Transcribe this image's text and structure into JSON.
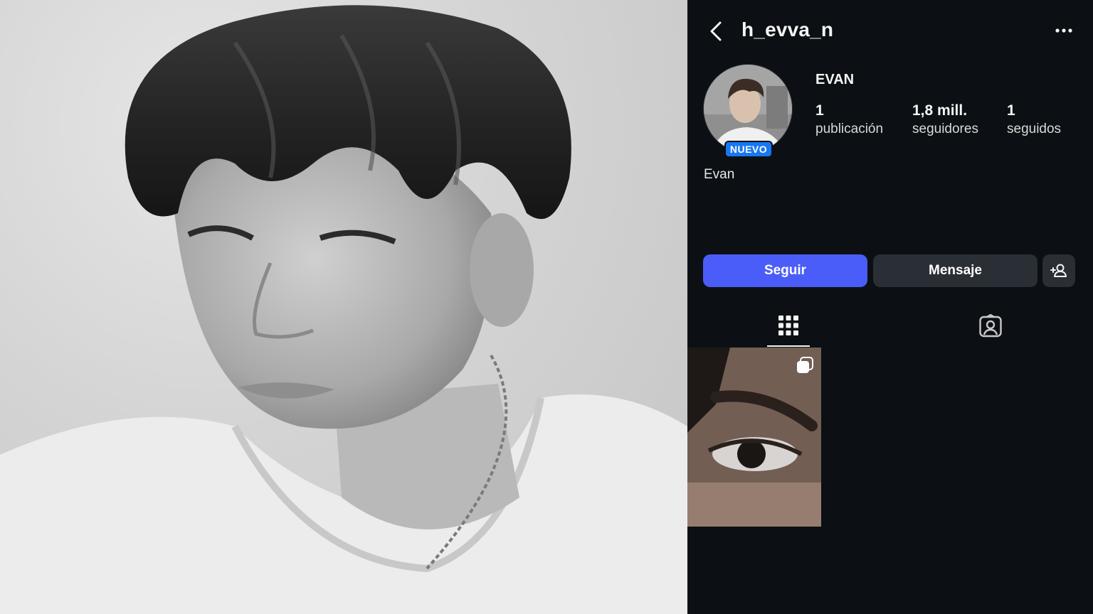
{
  "profile": {
    "username": "h_evva_n",
    "display_name": "EVAN",
    "badge": "NUEVO",
    "bio_name": "Evan",
    "stats": {
      "posts_count": "1",
      "posts_label": "publicación",
      "followers_count": "1,8 mill.",
      "followers_label": "seguidores",
      "following_count": "1",
      "following_label": "seguidos"
    },
    "buttons": {
      "follow": "Seguir",
      "message": "Mensaje"
    }
  },
  "icons": {
    "back": "chevron-left-icon",
    "more": "more-horizontal-icon",
    "suggest": "add-person-icon",
    "grid": "grid-icon",
    "tagged": "tagged-person-icon",
    "carousel": "carousel-icon"
  },
  "colors": {
    "background": "#0c1014",
    "follow_button": "#4a5df9",
    "secondary_button": "#2a2e35",
    "badge": "#1877f2"
  }
}
